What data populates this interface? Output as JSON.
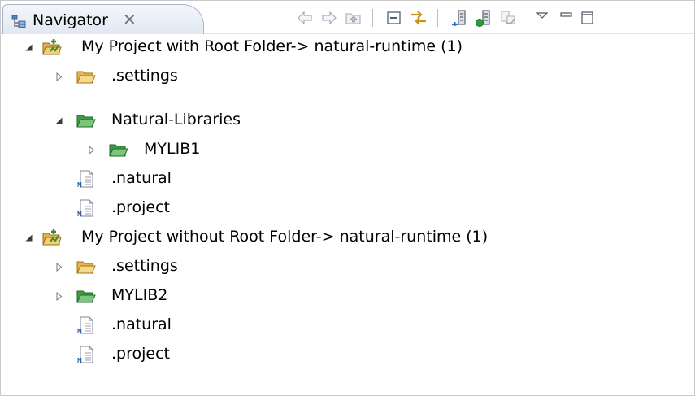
{
  "view": {
    "tab_title": "Navigator",
    "close_glyph": "✕"
  },
  "toolbar": {
    "buttons": [
      "back-icon",
      "forward-icon",
      "up-icon",
      "collapse-all-icon",
      "link-with-editor-icon",
      "new-natural-project-icon",
      "new-natural-library-icon",
      "refresh-icon",
      "view-menu-icon",
      "minimize-icon",
      "maximize-icon"
    ]
  },
  "tree": {
    "nodes": [
      {
        "label": "My Project with Root Folder-> natural-runtime (1)",
        "type": "project",
        "expanded": true,
        "level": 0
      },
      {
        "label": ".settings",
        "type": "folder",
        "expanded": false,
        "level": 1
      },
      {
        "label": "Natural-Libraries",
        "type": "library-folder",
        "expanded": true,
        "level": 1
      },
      {
        "label": "MYLIB1",
        "type": "library-folder",
        "expanded": false,
        "level": 2
      },
      {
        "label": ".natural",
        "type": "file",
        "level": 1
      },
      {
        "label": ".project",
        "type": "file",
        "level": 1
      },
      {
        "label": "My Project without Root Folder-> natural-runtime (1)",
        "type": "project",
        "expanded": true,
        "level": 0
      },
      {
        "label": ".settings",
        "type": "folder",
        "expanded": false,
        "level": 1
      },
      {
        "label": "MYLIB2",
        "type": "library-folder",
        "expanded": false,
        "level": 1
      },
      {
        "label": ".natural",
        "type": "file",
        "level": 1
      },
      {
        "label": ".project",
        "type": "file",
        "level": 1
      }
    ]
  }
}
